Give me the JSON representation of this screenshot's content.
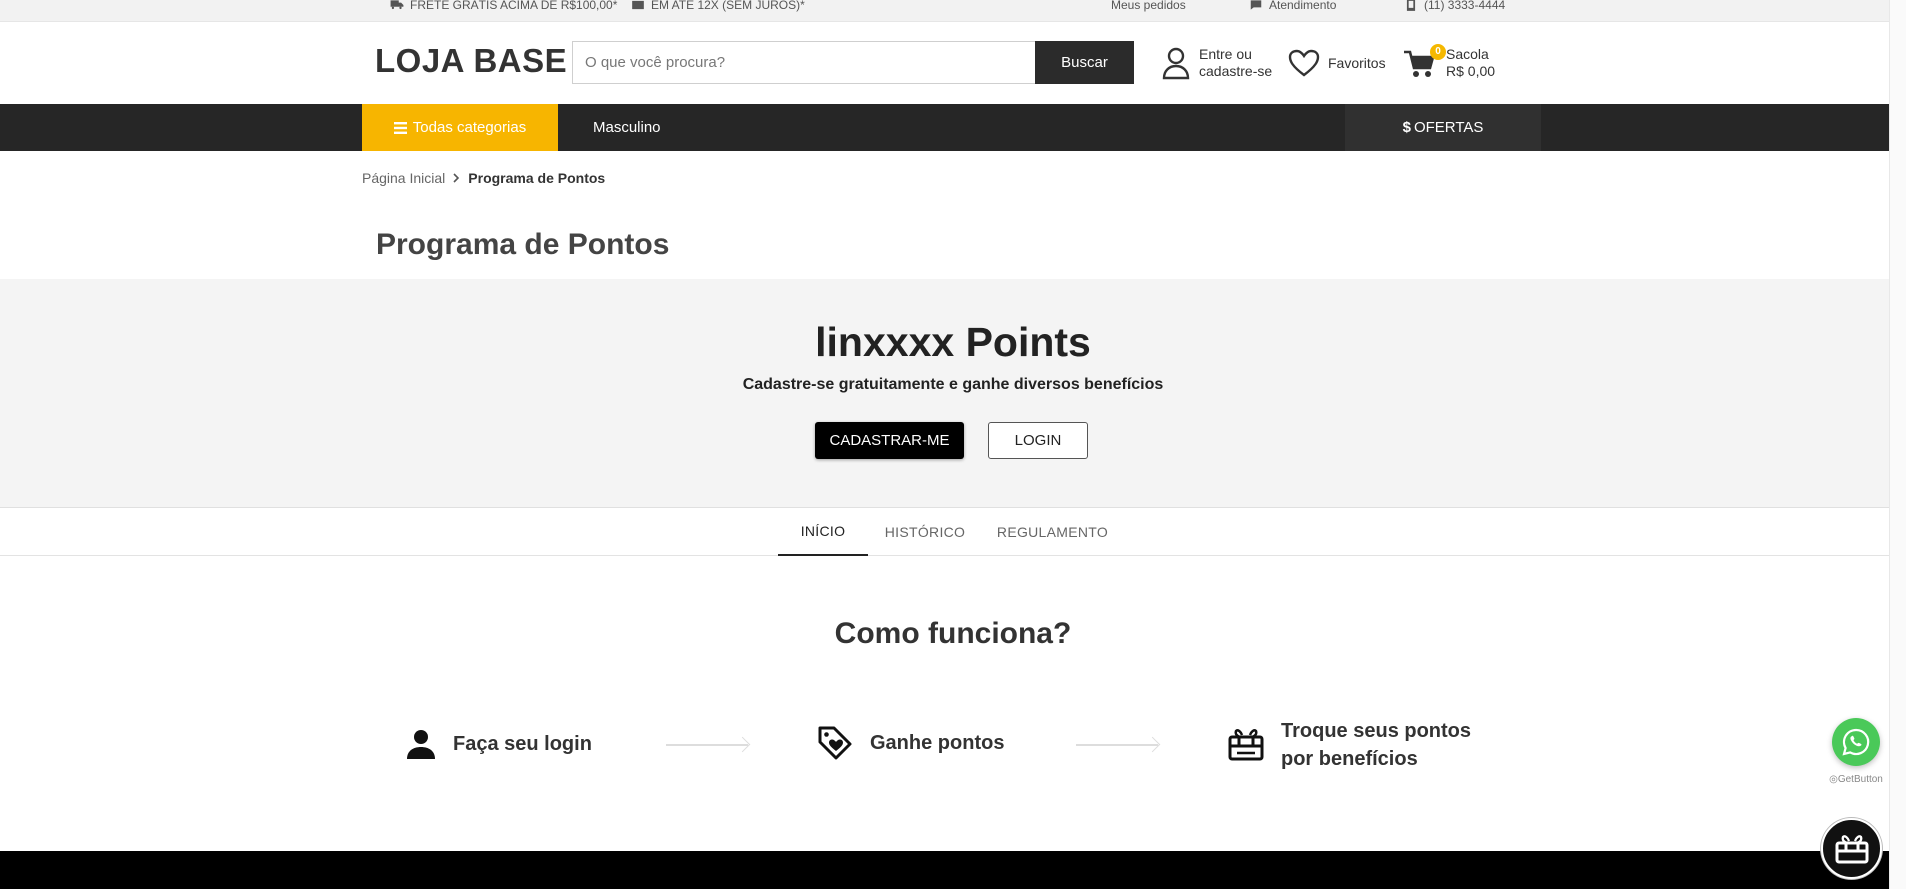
{
  "topbar": {
    "shipping": "FRETE GRÁTIS ACIMA DE R$100,00*",
    "installments": "EM ATÉ 12X (SEM JUROS)*",
    "orders": "Meus pedidos",
    "support": "Atendimento",
    "phone": "(11) 3333-4444"
  },
  "header": {
    "logo": "LOJA BASE",
    "search_placeholder": "O que você procura?",
    "search_button": "Buscar",
    "account_line1": "Entre ou",
    "account_line2": "cadastre-se",
    "favorites": "Favoritos",
    "cart_label": "Sacola",
    "cart_total": "R$ 0,00",
    "cart_count": "0"
  },
  "nav": {
    "all_categories": "Todas categorias",
    "link": "Masculino",
    "offers": "OFERTAS"
  },
  "breadcrumb": {
    "home": "Página Inicial",
    "current": "Programa de Pontos"
  },
  "page": {
    "title": "Programa de Pontos"
  },
  "hero": {
    "title": "linxxxx Points",
    "subtitle": "Cadastre-se gratuitamente e ganhe diversos benefícios",
    "register_button": "CADASTRAR-ME",
    "login_button": "LOGIN"
  },
  "tabs": [
    {
      "label": "INÍCIO"
    },
    {
      "label": "HISTÓRICO"
    },
    {
      "label": "REGULAMENTO"
    }
  ],
  "how": {
    "title": "Como funciona?",
    "steps": [
      {
        "label": "Faça seu login",
        "icon": "user-icon"
      },
      {
        "label": "Ganhe pontos",
        "icon": "tag-heart-icon"
      },
      {
        "label_line1": "Troque seus pontos",
        "label_line2": "por benefícios",
        "icon": "gift-card-icon"
      }
    ]
  },
  "floating": {
    "getbutton_label": "GetButton"
  },
  "colors": {
    "accent": "#f7b500",
    "navbar": "#262626",
    "whatsapp": "#4ac959"
  }
}
